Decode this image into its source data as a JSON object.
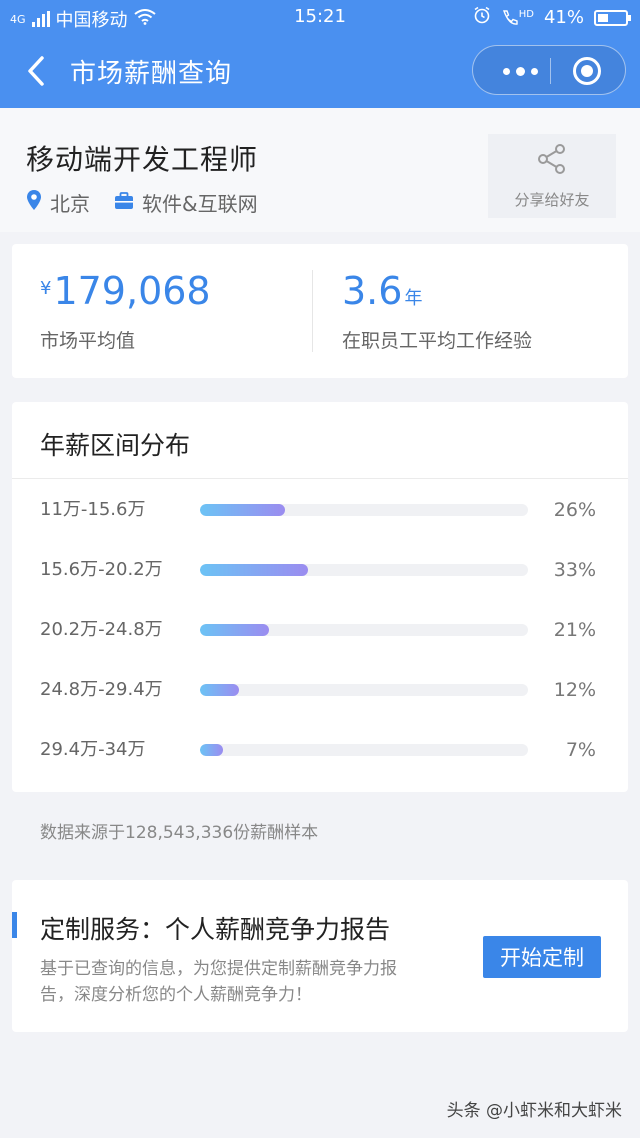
{
  "status_bar": {
    "network": "4G",
    "carrier": "中国移动",
    "time": "15:21",
    "hd": "HD",
    "battery": "41%"
  },
  "nav": {
    "title": "市场薪酬查询",
    "back_icon": "chevron-left-icon",
    "more_icon": "ellipsis-icon",
    "close_icon": "target-circle-icon"
  },
  "job": {
    "title": "移动端开发工程师",
    "city": "北京",
    "industry": "软件&互联网",
    "share_label": "分享给好友"
  },
  "stats": {
    "salary_prefix": "¥",
    "salary_value": "179,068",
    "salary_label": "市场平均值",
    "experience_value": "3.6",
    "experience_unit": "年",
    "experience_label": "在职员工平均工作经验"
  },
  "distribution": {
    "title": "年薪区间分布",
    "rows": [
      {
        "range": "11万-15.6万",
        "percent": "26%",
        "value": 26
      },
      {
        "range": "15.6万-20.2万",
        "percent": "33%",
        "value": 33
      },
      {
        "range": "20.2万-24.8万",
        "percent": "21%",
        "value": 21
      },
      {
        "range": "24.8万-29.4万",
        "percent": "12%",
        "value": 12
      },
      {
        "range": "29.4万-34万",
        "percent": "7%",
        "value": 7
      }
    ]
  },
  "source_note": "数据来源于128,543,336份薪酬样本",
  "service": {
    "title": "定制服务：个人薪酬竞争力报告",
    "description": "基于已查询的信息，为您提供定制薪酬竞争力报告，深度分析您的个人薪酬竞争力！",
    "button_label": "开始定制"
  },
  "watermark": "头条 @小虾米和大虾米",
  "colors": {
    "brand": "#4a90f0",
    "accent": "#3a86e8",
    "bar_start": "#6cc3f5",
    "bar_end": "#9b8cf0"
  }
}
